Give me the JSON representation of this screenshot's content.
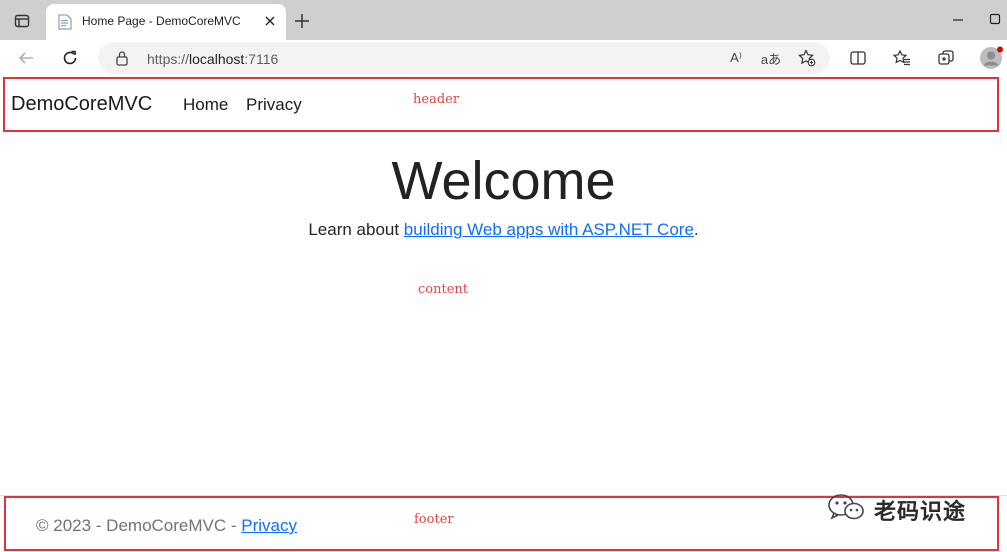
{
  "browser": {
    "tab_title": "Home Page - DemoCoreMVC",
    "url_scheme": "https://",
    "url_host": "localhost",
    "url_port": ":7116",
    "read_aloud_glyph": "A⁾",
    "translate_glyph": "aあ"
  },
  "navbar": {
    "brand": "DemoCoreMVC",
    "links": [
      "Home",
      "Privacy"
    ]
  },
  "main": {
    "heading": "Welcome",
    "learn_prefix": "Learn about ",
    "learn_link": "building Web apps with ASP.NET Core",
    "learn_suffix": "."
  },
  "footer": {
    "copyright": "© 2023 - DemoCoreMVC - ",
    "privacy_link": "Privacy"
  },
  "annotations": {
    "header": "header",
    "content": "content",
    "footer": "footer"
  },
  "watermark": {
    "text": "老码识途"
  },
  "colors": {
    "annotation": "#d9363e",
    "link": "#0d6efd",
    "tabstrip": "#cfcfcf"
  }
}
